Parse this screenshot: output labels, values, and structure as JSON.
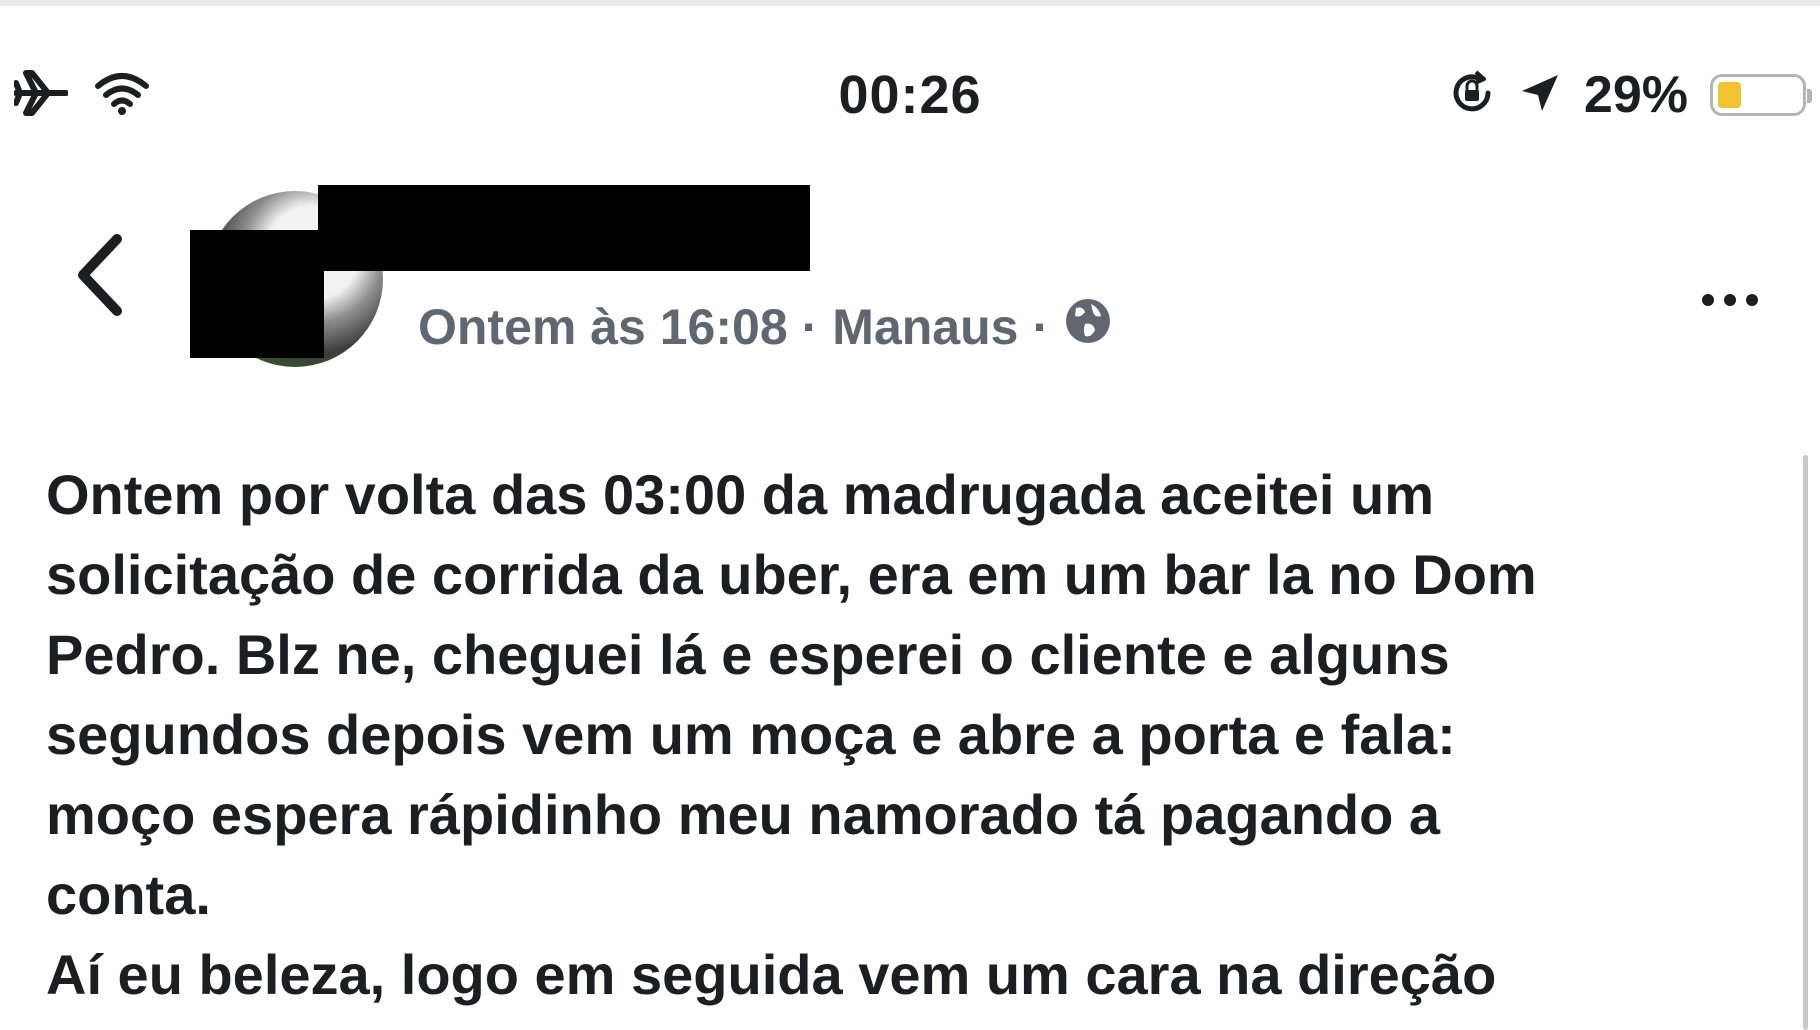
{
  "status_bar": {
    "time": "00:26",
    "battery_percent": "29%",
    "battery_level": 0.29,
    "battery_color": "#f2c230",
    "left_icons": [
      "airplane-icon",
      "wifi-icon"
    ],
    "right_icons": [
      "orientation-lock-icon",
      "location-arrow-icon"
    ]
  },
  "post_header": {
    "timestamp": "Ontem às 16:08",
    "location": "Manaus",
    "separator": "·",
    "privacy_icon": "globe-icon",
    "back_icon": "chevron-left-icon",
    "more_icon": "more-dots-icon"
  },
  "post": {
    "lines": [
      "Ontem por volta das 03:00 da madrugada aceitei um",
      "solicitação de corrida da uber, era em um bar la no Dom",
      "Pedro. Blz ne, cheguei lá e esperei o cliente e alguns",
      "segundos depois vem um moça e abre a porta e fala:",
      "moço espera rápidinho meu namorado tá pagando a",
      "conta.",
      "Aí eu beleza, logo em seguida vem um cara na direção"
    ]
  }
}
